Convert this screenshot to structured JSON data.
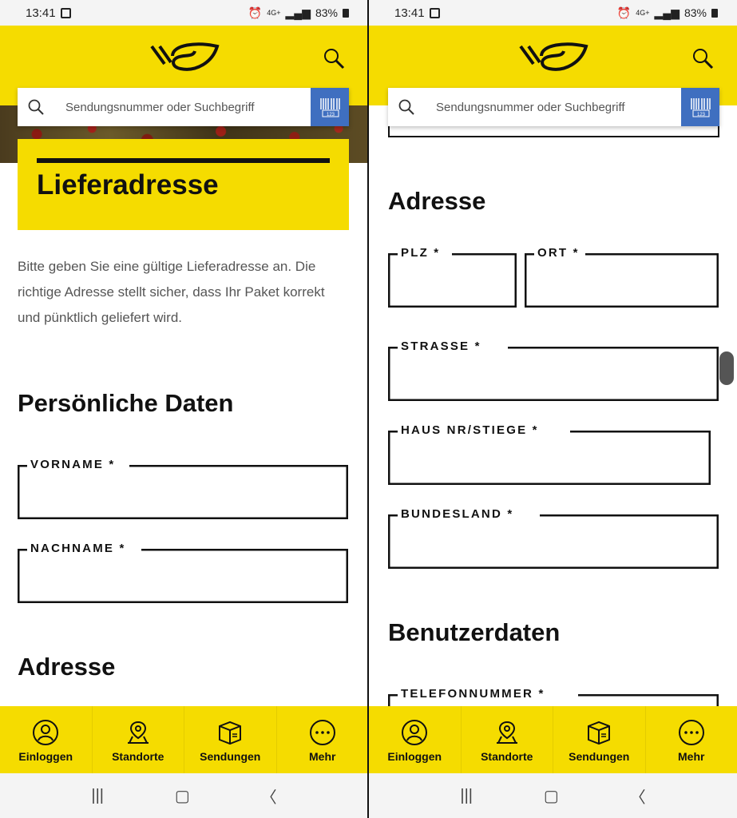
{
  "status": {
    "time": "13:41",
    "battery": "83%",
    "network": "4G+"
  },
  "search": {
    "placeholder": "Sendungsnummer oder Suchbegriff"
  },
  "page": {
    "title": "Lieferadresse",
    "intro": "Bitte geben Sie eine gültige Lieferadresse an. Die richtige Adresse stellt sicher, dass Ihr Paket korrekt und pünktlich geliefert wird."
  },
  "sections": {
    "personal": "Persönliche Daten",
    "address": "Adresse",
    "user": "Benutzerdaten"
  },
  "fields": {
    "vorname": "VORNAME *",
    "nachname": "NACHNAME *",
    "plz": "PLZ *",
    "ort": "ORT *",
    "strasse": "STRASSE *",
    "hausnr": "HAUS NR/STIEGE *",
    "bundesland": "BUNDESLAND *",
    "telefon": "TELEFONNUMMER *"
  },
  "nav": [
    {
      "label": "Einloggen",
      "icon": "user-icon"
    },
    {
      "label": "Standorte",
      "icon": "location-icon"
    },
    {
      "label": "Sendungen",
      "icon": "package-icon"
    },
    {
      "label": "Mehr",
      "icon": "more-icon"
    }
  ],
  "colors": {
    "brand_yellow": "#f5dc00",
    "barcode_blue": "#3f6fc0"
  }
}
